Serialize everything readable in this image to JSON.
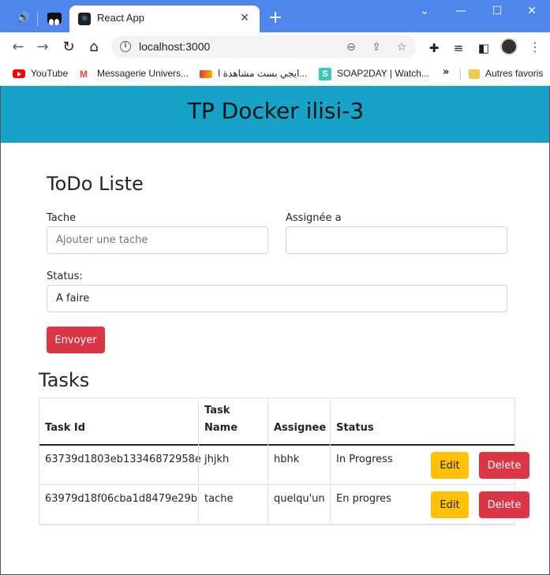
{
  "browser": {
    "tab_title": "React App",
    "url": "localhost:3000",
    "bookmarks": [
      {
        "label": "YouTube",
        "icon": "youtube-icon"
      },
      {
        "label": "Messagerie Univers...",
        "icon": "gmail-icon"
      },
      {
        "label": "ايجي بست مشاهدة ا...",
        "icon": "egybest-icon"
      },
      {
        "label": "SOAP2DAY | Watch...",
        "icon": "soap2day-icon"
      }
    ],
    "bookmarks_more": "»",
    "other_bookmarks": "Autres favoris",
    "accent_color": "#4f86ec"
  },
  "app": {
    "banner_title": "TP Docker ilisi-3",
    "banner_color": "#17a2c7",
    "form": {
      "title": "ToDo Liste",
      "task_label": "Tache",
      "task_placeholder": "Ajouter une tache",
      "assignee_label": "Assignée a",
      "assignee_value": "",
      "status_label": "Status:",
      "status_value": "A faire",
      "submit_label": "Envoyer"
    },
    "tasks": {
      "title": "Tasks",
      "columns": [
        "Task Id",
        "Task Name",
        "Assignee",
        "Status"
      ],
      "rows": [
        {
          "id": "63739d1803eb13346872958e",
          "name": "jhjkh",
          "assignee": "hbhk",
          "status": "In Progress",
          "edit": "Edit",
          "delete": "Delete"
        },
        {
          "id": "63979d18f06cba1d8479e29b",
          "name": "tache",
          "assignee": "quelqu'un",
          "status": "En progres",
          "edit": "Edit",
          "delete": "Delete"
        }
      ]
    }
  }
}
